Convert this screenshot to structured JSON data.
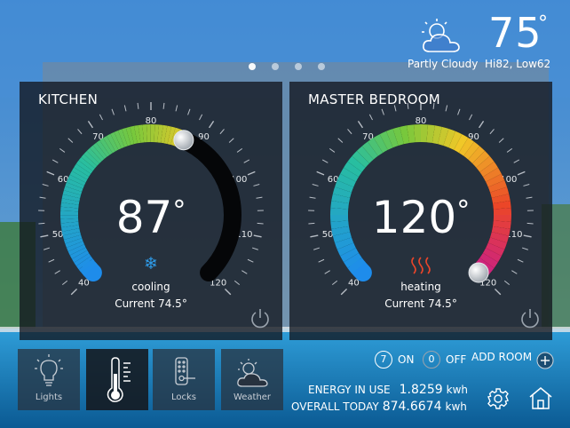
{
  "weather": {
    "icon": "partly-cloudy-icon",
    "temperature": "75",
    "degree_symbol": "°",
    "condition": "Partly Cloudy",
    "hi_lo": "Hi82, Low62"
  },
  "pagination": {
    "count": 4,
    "active": 0
  },
  "rooms": [
    {
      "name": "KITCHEN",
      "set_temp": "87",
      "degree_symbol": "°",
      "mode": "cooling",
      "mode_icon": "snowflake-icon",
      "current_label": "Current",
      "current_temp": "74.5°",
      "dial_value": 87,
      "scale_labels": [
        "40",
        "50",
        "60",
        "70",
        "80",
        "90",
        "100",
        "110",
        "120"
      ],
      "mode_color": "#1e90e8"
    },
    {
      "name": "MASTER BEDROOM",
      "set_temp": "120",
      "degree_symbol": "°",
      "mode": "heating",
      "mode_icon": "heat-waves-icon",
      "current_label": "Current",
      "current_temp": "74.5°",
      "dial_value": 120,
      "scale_labels": [
        "40",
        "50",
        "60",
        "70",
        "80",
        "90",
        "100",
        "110",
        "120"
      ],
      "mode_color": "#e8452a"
    }
  ],
  "tiles": [
    {
      "label": "Lights",
      "icon": "lightbulb-icon"
    },
    {
      "label": "",
      "icon": "thermometer-icon"
    },
    {
      "label": "Locks",
      "icon": "lock-icon"
    },
    {
      "label": "Weather",
      "icon": "weather-icon"
    }
  ],
  "status": {
    "on_count": "7",
    "on_label": "ON",
    "off_count": "0",
    "off_label": "OFF",
    "add_room_label": "ADD ROOM"
  },
  "energy": {
    "in_use_label": "ENERGY IN USE",
    "in_use_value": "1.8259",
    "in_use_unit": "kwh",
    "overall_label": "OVERALL TODAY",
    "overall_value": "874.6674",
    "overall_unit": "kwh"
  },
  "colors": {
    "panel": "#12161e",
    "accent_cool": "#1e90e8",
    "accent_hot": "#e8452a"
  }
}
